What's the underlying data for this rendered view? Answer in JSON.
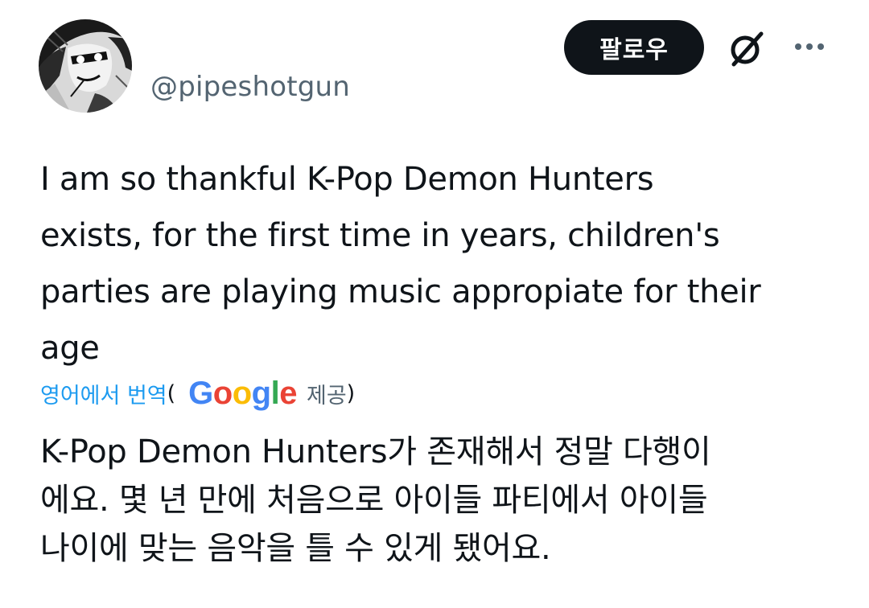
{
  "author": {
    "handle": "@pipeshotgun"
  },
  "actions": {
    "follow_label": "팔로우"
  },
  "tweet": {
    "lines": [
      "I am so thankful K-Pop Demon Hunters",
      "exists, for the first time in years, children's",
      "parties are playing music appropiate for their",
      "age"
    ]
  },
  "translation": {
    "link_label": "영어에서 번역",
    "open_paren": "(",
    "provider_logo": {
      "g1": "G",
      "o1": "o",
      "o2": "o",
      "g2": "g",
      "l": "l",
      "e": "e"
    },
    "provided_label": "제공",
    "close_paren": ")",
    "lines": [
      "K-Pop Demon Hunters가 존재해서 정말 다행이",
      "에요. 몇 년 만에 처음으로 아이들 파티에서 아이들",
      "나이에 맞는 음악을 틀 수 있게 됐어요."
    ]
  },
  "colors": {
    "text": "#0f1419",
    "secondary": "#536471",
    "link": "#1d9bf0",
    "button_bg": "#0f1419"
  },
  "icons": [
    "avatar",
    "grok-icon",
    "more-icon"
  ]
}
